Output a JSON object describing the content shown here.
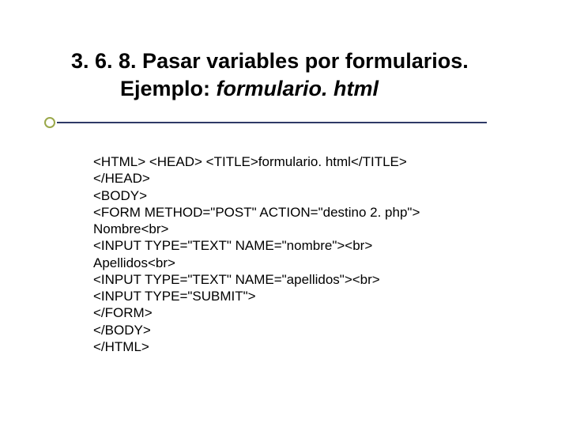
{
  "title": {
    "line1": "3. 6. 8. Pasar variables por formularios.",
    "line2_prefix": "Ejemplo: ",
    "line2_italic": "formulario. html"
  },
  "code": {
    "l1": "<HTML> <HEAD> <TITLE>formulario. html</TITLE>",
    "l2": "</HEAD>",
    "l3": "<BODY>",
    "l4": "<FORM METHOD=\"POST\" ACTION=\"destino 2. php\">",
    "l5": "Nombre<br>",
    "l6": "<INPUT TYPE=\"TEXT\" NAME=\"nombre\"><br>",
    "l7": "Apellidos<br>",
    "l8": "<INPUT TYPE=\"TEXT\" NAME=\"apellidos\"><br>",
    "l9": "<INPUT TYPE=\"SUBMIT\">",
    "l10": "</FORM>",
    "l11": "</BODY>",
    "l12": "</HTML>"
  }
}
